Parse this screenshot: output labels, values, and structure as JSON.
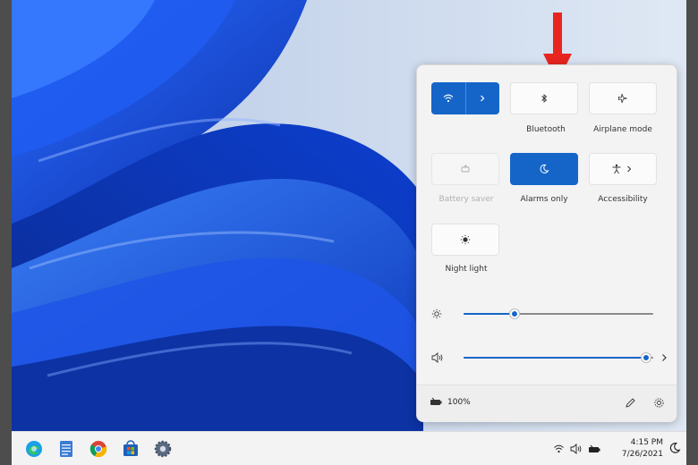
{
  "quick_settings": {
    "tiles": [
      {
        "id": "wifi",
        "label": "",
        "state": "on",
        "icon": "wifi-icon"
      },
      {
        "id": "bluetooth",
        "label": "Bluetooth",
        "state": "off",
        "icon": "bluetooth-icon"
      },
      {
        "id": "airplane",
        "label": "Airplane mode",
        "state": "off",
        "icon": "airplane-icon"
      },
      {
        "id": "battery_saver",
        "label": "Battery saver",
        "state": "disabled",
        "icon": "battery-saver-icon"
      },
      {
        "id": "focus_assist",
        "label": "Alarms only",
        "state": "on",
        "icon": "moon-icon"
      },
      {
        "id": "accessibility",
        "label": "Accessibility",
        "state": "off",
        "icon": "accessibility-icon"
      },
      {
        "id": "night_light",
        "label": "Night light",
        "state": "off",
        "icon": "night-light-icon"
      }
    ],
    "brightness": {
      "value": 0.27,
      "icon": "sun-icon"
    },
    "volume": {
      "value": 0.96,
      "icon": "speaker-icon"
    },
    "footer": {
      "battery_text": "100%"
    }
  },
  "taskbar": {
    "apps": [
      "edge-icon",
      "notepad-icon",
      "chrome-icon",
      "store-icon",
      "settings-icon"
    ],
    "clock": {
      "time": "4:15 PM",
      "date": "7/26/2021"
    }
  },
  "colors": {
    "accent": "#1565c9",
    "annotation": "#e8251f"
  }
}
